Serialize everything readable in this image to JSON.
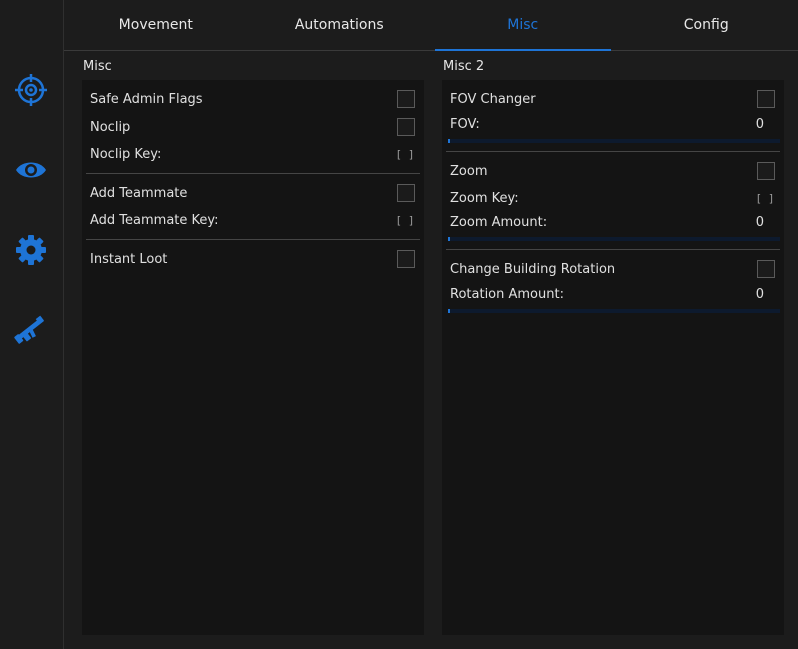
{
  "theme": {
    "accent": "#1e74d6",
    "background": "#1c1c1c",
    "panel": "#141414"
  },
  "sidebar": {
    "icons": [
      {
        "name": "crosshair-icon"
      },
      {
        "name": "eye-icon"
      },
      {
        "name": "gear-icon"
      },
      {
        "name": "rifle-icon"
      }
    ]
  },
  "tabs": [
    {
      "label": "Movement",
      "active": false
    },
    {
      "label": "Automations",
      "active": false
    },
    {
      "label": "Misc",
      "active": true
    },
    {
      "label": "Config",
      "active": false
    }
  ],
  "misc": {
    "title": "Misc",
    "safe_admin_flags": "Safe Admin Flags",
    "noclip": "Noclip",
    "noclip_key": "Noclip Key:",
    "add_teammate": "Add Teammate",
    "add_teammate_key": "Add Teammate Key:",
    "instant_loot": "Instant Loot",
    "key_placeholder": "[ ]"
  },
  "misc2": {
    "title": "Misc 2",
    "fov_changer": "FOV Changer",
    "fov_label": "FOV:",
    "fov_value": "0",
    "zoom": "Zoom",
    "zoom_key": "Zoom Key:",
    "zoom_amount_label": "Zoom Amount:",
    "zoom_amount_value": "0",
    "change_building_rotation": "Change Building Rotation",
    "rotation_amount_label": "Rotation Amount:",
    "rotation_amount_value": "0",
    "key_placeholder": "[ ]"
  }
}
